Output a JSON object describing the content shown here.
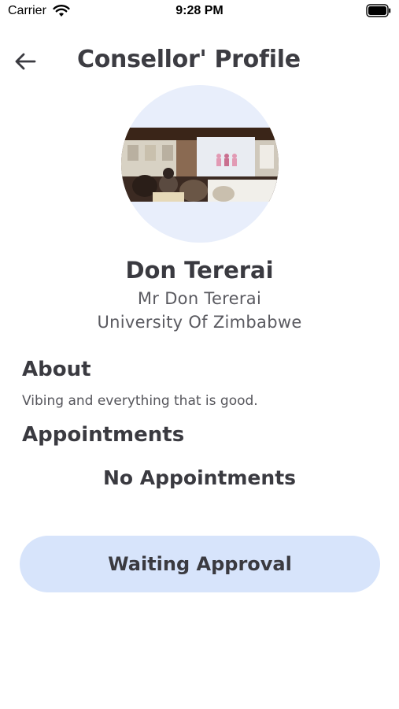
{
  "status_bar": {
    "carrier": "Carrier",
    "time": "9:28 PM",
    "wifi_icon": "wifi-icon",
    "battery_icon": "battery-icon"
  },
  "header": {
    "back_icon": "arrow-left-icon",
    "title": "Consellor' Profile"
  },
  "profile": {
    "avatar": "profile-photo",
    "name": "Don Tererai",
    "title": "Mr Don Tererai",
    "organization": "University Of Zimbabwe"
  },
  "about": {
    "heading": "About",
    "text": "Vibing and everything that is good."
  },
  "appointments": {
    "heading": "Appointments",
    "empty_text": "No Appointments"
  },
  "action": {
    "label": "Waiting Approval",
    "color": "#d7e4fb"
  },
  "colors": {
    "avatar_background": "#e8eefb",
    "text_primary": "#3a3a40"
  }
}
